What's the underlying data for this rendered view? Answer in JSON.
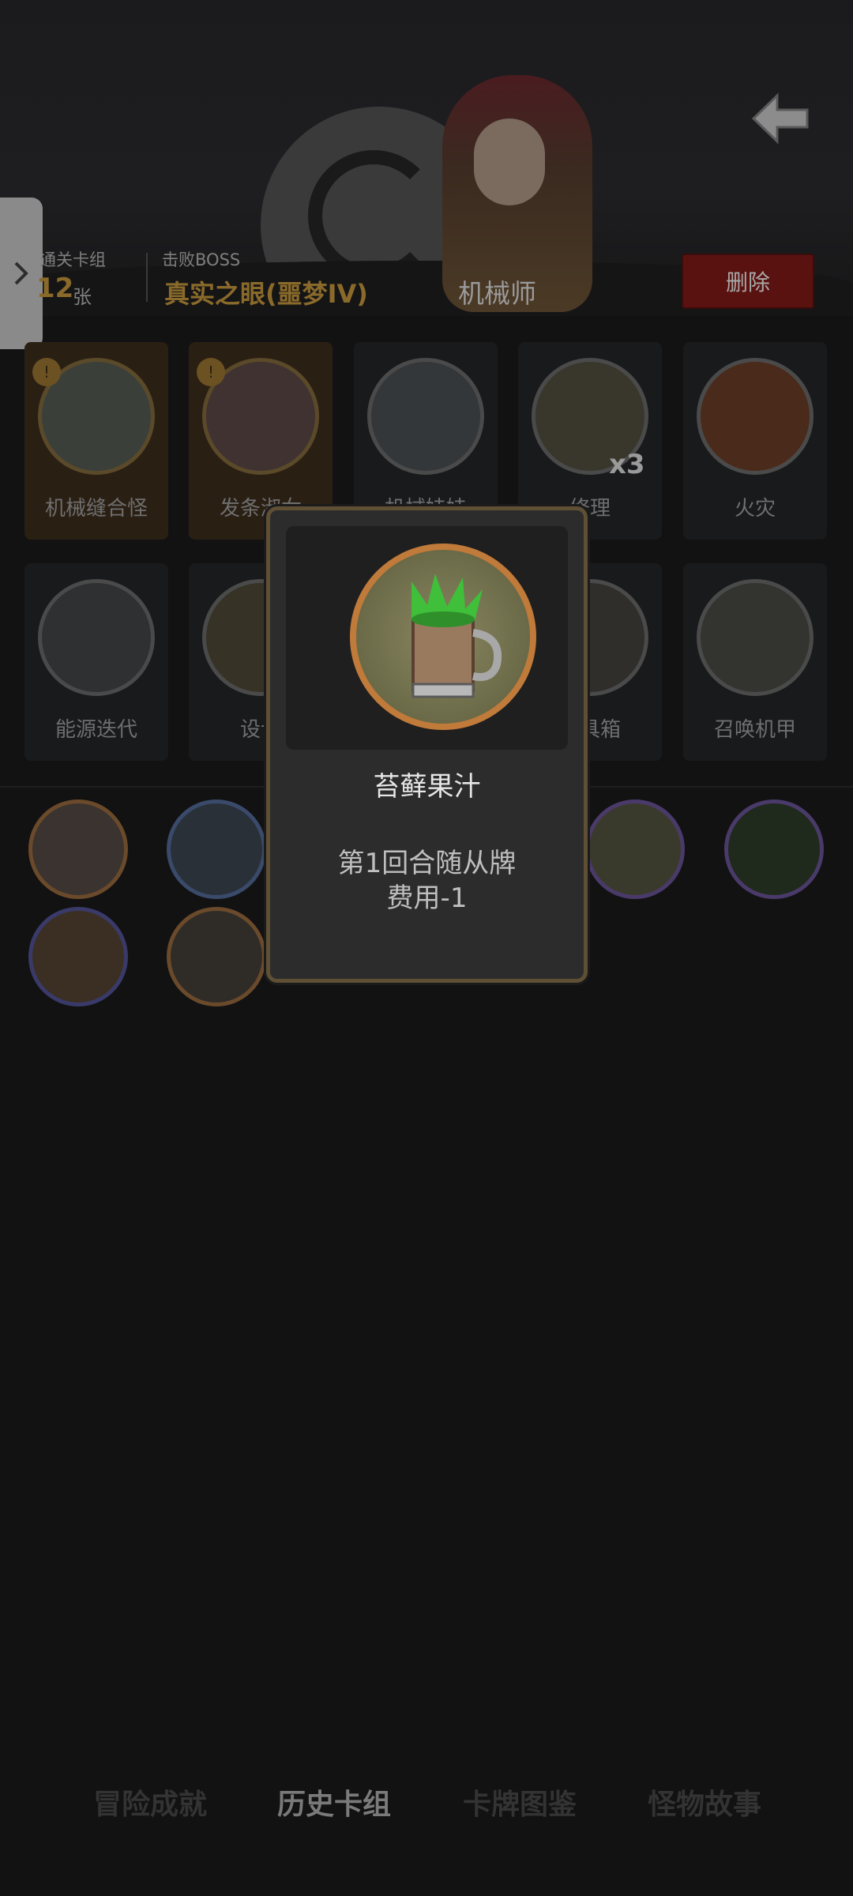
{
  "header": {
    "deck_label": "通关卡组",
    "deck_count": "12",
    "deck_unit": "张",
    "boss_label": "击败BOSS",
    "boss_name": "真实之眼(噩梦IV)",
    "class_name": "机械师",
    "delete_label": "删除",
    "back_icon": "arrow-left-icon",
    "side_tab_icon": "chevron-right-icon"
  },
  "cards_row1": [
    {
      "label": "机械缝合怪",
      "style": "gold",
      "badge": "!"
    },
    {
      "label": "发条淑女",
      "style": "gold",
      "badge": "!"
    },
    {
      "label": "机械娃娃",
      "style": "dark"
    },
    {
      "label": "修理",
      "style": "dark",
      "multiplier": "x3"
    },
    {
      "label": "火灾",
      "style": "dark"
    }
  ],
  "cards_row2": [
    {
      "label": "能源迭代",
      "style": "dark"
    },
    {
      "label": "设计",
      "style": "dark"
    },
    {
      "label": "",
      "style": "dark"
    },
    {
      "label": "工具箱",
      "style": "dark"
    },
    {
      "label": "召唤机甲",
      "style": "dark"
    }
  ],
  "modal": {
    "name": "苔藓果汁",
    "desc_line1": "第1回合随从牌",
    "desc_line2": "费用-1",
    "icon": "moss-juice-mug-icon"
  },
  "colors": {
    "accent_gold": "#8a6a2a",
    "delete_red": "#5a1210",
    "modal_border": "#5e4f35"
  },
  "bottom_nav": [
    {
      "label": "冒险成就",
      "active": false
    },
    {
      "label": "历史卡组",
      "active": true
    },
    {
      "label": "卡牌图鉴",
      "active": false
    },
    {
      "label": "怪物故事",
      "active": false
    }
  ]
}
